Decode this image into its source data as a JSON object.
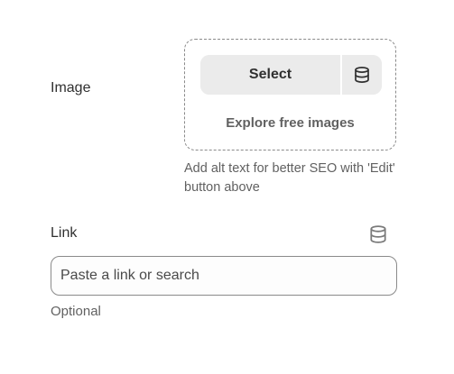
{
  "image_field": {
    "label": "Image",
    "select_label": "Select",
    "select_icon": "database-icon",
    "explore_label": "Explore free images",
    "help_text": "Add alt text for better SEO with 'Edit' button above"
  },
  "link_field": {
    "label": "Link",
    "icon": "database-icon",
    "value": "",
    "placeholder": "Paste a link or search",
    "help_text": "Optional"
  }
}
